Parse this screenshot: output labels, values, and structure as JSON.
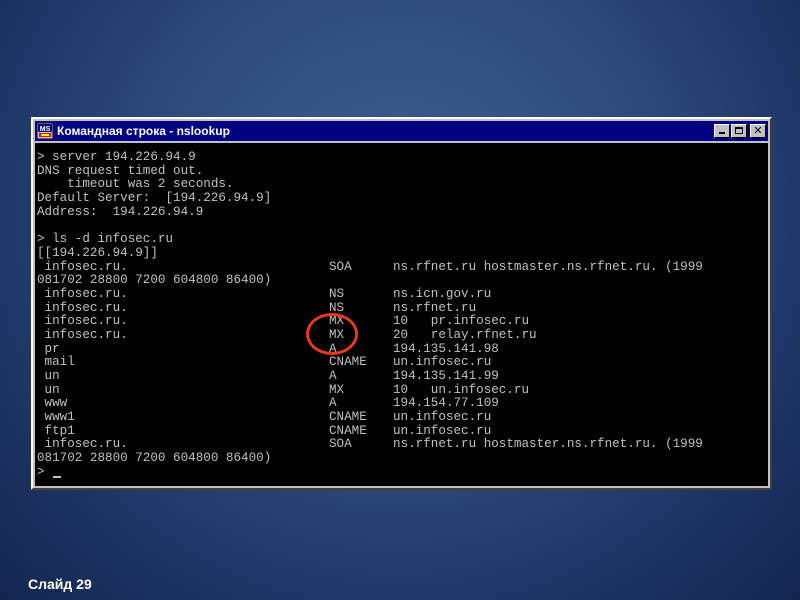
{
  "window": {
    "title": "Командная строка - nslookup",
    "icon": "msdos-icon",
    "icon_text": "MS"
  },
  "console": {
    "lines": [
      {
        "c1": "> server 194.226.94.9",
        "c2": "",
        "c3": ""
      },
      {
        "c1": "DNS request timed out.",
        "c2": "",
        "c3": ""
      },
      {
        "c1": "    timeout was 2 seconds.",
        "c2": "",
        "c3": ""
      },
      {
        "c1": "Default Server:  [194.226.94.9]",
        "c2": "",
        "c3": ""
      },
      {
        "c1": "Address:  194.226.94.9",
        "c2": "",
        "c3": ""
      },
      {
        "c1": "",
        "c2": "",
        "c3": ""
      },
      {
        "c1": "> ls -d infosec.ru",
        "c2": "",
        "c3": ""
      },
      {
        "c1": "[[194.226.94.9]]",
        "c2": "",
        "c3": ""
      },
      {
        "c1": " infosec.ru.",
        "c2": "SOA",
        "c3": "ns.rfnet.ru hostmaster.ns.rfnet.ru. (1999"
      },
      {
        "c1": "081702 28800 7200 604800 86400)",
        "c2": "",
        "c3": ""
      },
      {
        "c1": " infosec.ru.",
        "c2": "NS",
        "c3": "ns.icn.gov.ru"
      },
      {
        "c1": " infosec.ru.",
        "c2": "NS",
        "c3": "ns.rfnet.ru"
      },
      {
        "c1": " infosec.ru.",
        "c2": "MX",
        "c3": "10   pr.infosec.ru"
      },
      {
        "c1": " infosec.ru.",
        "c2": "MX",
        "c3": "20   relay.rfnet.ru"
      },
      {
        "c1": " pr",
        "c2": "A",
        "c3": "194.135.141.98"
      },
      {
        "c1": " mail",
        "c2": "CNAME",
        "c3": "un.infosec.ru"
      },
      {
        "c1": " un",
        "c2": "A",
        "c3": "194.135.141.99"
      },
      {
        "c1": " un",
        "c2": "MX",
        "c3": "10   un.infosec.ru"
      },
      {
        "c1": " www",
        "c2": "A",
        "c3": "194.154.77.109"
      },
      {
        "c1": " www1",
        "c2": "CNAME",
        "c3": "un.infosec.ru"
      },
      {
        "c1": " ftp1",
        "c2": "CNAME",
        "c3": "un.infosec.ru"
      },
      {
        "c1": " infosec.ru.",
        "c2": "SOA",
        "c3": "ns.rfnet.ru hostmaster.ns.rfnet.ru. (1999"
      },
      {
        "c1": "081702 28800 7200 604800 86400)",
        "c2": "",
        "c3": ""
      }
    ],
    "prompt": ">"
  },
  "slide": {
    "label": "Слайд 29"
  },
  "colors": {
    "highlight": "#e8391f",
    "titlebar": "#000080",
    "console_bg": "#000000",
    "console_fg": "#c0c0c0"
  }
}
